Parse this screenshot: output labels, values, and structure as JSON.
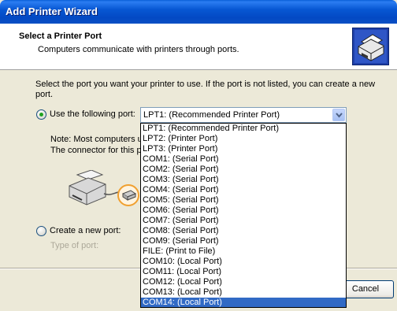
{
  "window": {
    "title": "Add Printer Wizard"
  },
  "header": {
    "title": "Select a Printer Port",
    "subtitle": "Computers communicate with printers through ports."
  },
  "intro": "Select the port you want your printer to use.  If the port is not listed, you can create a new port.",
  "use_port": {
    "label": "Use the following port:",
    "selected": "LPT1: (Recommended Printer Port)"
  },
  "note": {
    "line1": "Note: Most computers u",
    "line2": "The connector for this p"
  },
  "create_port": {
    "label": "Create a new port:",
    "type_label": "Type of port:"
  },
  "port_options": [
    "LPT1: (Recommended Printer Port)",
    "LPT2: (Printer Port)",
    "LPT3: (Printer Port)",
    "COM1: (Serial Port)",
    "COM2: (Serial Port)",
    "COM3: (Serial Port)",
    "COM4: (Serial Port)",
    "COM5: (Serial Port)",
    "COM6: (Serial Port)",
    "COM7: (Serial Port)",
    "COM8: (Serial Port)",
    "COM9: (Serial Port)",
    "FILE: (Print to File)",
    "COM10: (Local Port)",
    "COM11: (Local Port)",
    "COM12: (Local Port)",
    "COM13: (Local Port)",
    "COM14: (Local Port)"
  ],
  "highlighted_index": 17,
  "buttons": {
    "cancel": "Cancel"
  },
  "icons": {
    "header": "printer-wizard-icon",
    "illustration": "printer-icon",
    "connector": "parallel-connector-icon",
    "dropdown": "chevron-down-icon"
  },
  "colors": {
    "titlebar": "#0757d3",
    "selection": "#316ac5",
    "dialog_bg": "#ece9d8",
    "radio_dot": "#21a121",
    "highlight_ring": "#f0a030"
  }
}
